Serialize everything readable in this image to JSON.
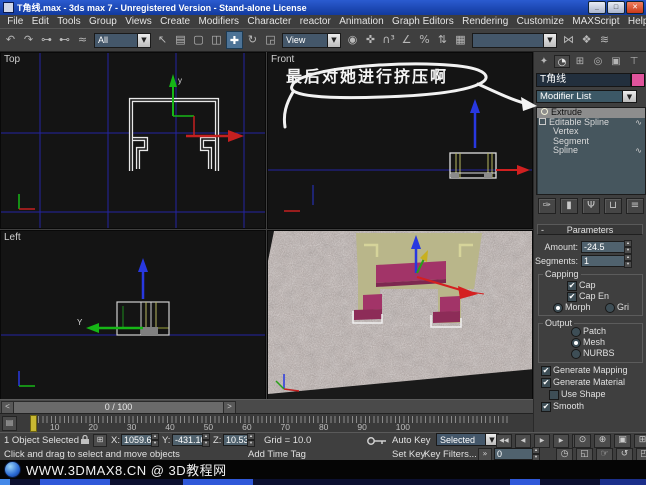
{
  "window": {
    "title": "T角线.max - 3ds max 7 - Unregistered Version - Stand-alone License",
    "minimize": "_",
    "maximize": "□",
    "close": "✕"
  },
  "menu": {
    "items": [
      "File",
      "Edit",
      "Tools",
      "Group",
      "Views",
      "Create",
      "Modifiers",
      "Character",
      "reactor",
      "Animation",
      "Graph Editors",
      "Rendering",
      "Customize",
      "MAXScript",
      "Help"
    ]
  },
  "toolbar": {
    "selection_filter": "All",
    "coord_system": "View",
    "named_selection": "",
    "group_a": [
      {
        "n": "undo-icon",
        "g": "↶"
      },
      {
        "n": "redo-icon",
        "g": "↷"
      },
      {
        "n": "select-and-link-icon",
        "g": "⊶"
      },
      {
        "n": "unlink-selection-icon",
        "g": "⊷"
      },
      {
        "n": "bind-to-spacewarp-icon",
        "g": "≈"
      }
    ],
    "group_b": [
      {
        "n": "select-object-icon",
        "g": "↖"
      },
      {
        "n": "select-by-name-icon",
        "g": "▤"
      },
      {
        "n": "rectangular-selection-icon",
        "g": "▢"
      },
      {
        "n": "window-crossing-icon",
        "g": "◫"
      },
      {
        "n": "select-and-move-icon",
        "g": "✚",
        "cls": "active"
      },
      {
        "n": "select-and-rotate-icon",
        "g": "↻"
      },
      {
        "n": "select-and-scale-icon",
        "g": "◲"
      }
    ],
    "group_c": [
      {
        "n": "use-center-icon",
        "g": "◉"
      },
      {
        "n": "select-and-manipulate-icon",
        "g": "✜"
      },
      {
        "n": "snap-toggle-icon",
        "g": "∩³"
      },
      {
        "n": "angle-snap-icon",
        "g": "∠"
      },
      {
        "n": "percent-snap-icon",
        "g": "%"
      },
      {
        "n": "spinner-snap-icon",
        "g": "⇅"
      },
      {
        "n": "named-selection-sets-icon",
        "g": "▦"
      }
    ],
    "group_d": [
      {
        "n": "mirror-icon",
        "g": "⋈"
      },
      {
        "n": "align-icon",
        "g": "❖"
      },
      {
        "n": "curve-editor-icon",
        "g": "≋"
      }
    ]
  },
  "viewports": {
    "top": {
      "label": "Top",
      "gizmo_axis": "y"
    },
    "front": {
      "label": "Front",
      "annotation": "最后对她进行挤压啊"
    },
    "left": {
      "label": "Left",
      "gizmo_axis": "Y"
    },
    "perspective": {}
  },
  "command_panel": {
    "tabs": [
      {
        "n": "tab-create",
        "g": "✦"
      },
      {
        "n": "tab-modify",
        "g": "◔",
        "cls": "pressed"
      },
      {
        "n": "tab-hierarchy",
        "g": "⊞"
      },
      {
        "n": "tab-motion",
        "g": "◎"
      },
      {
        "n": "tab-display",
        "g": "▣"
      },
      {
        "n": "tab-utilities",
        "g": "⊤"
      }
    ],
    "object_name": "T角线",
    "object_color": "#e0549c",
    "modifier_list_label": "Modifier List",
    "stack": {
      "extrude": "Extrude",
      "editable_spline": "Editable Spline",
      "vertex": "Vertex",
      "segment": "Segment",
      "spline": "Spline"
    },
    "stack_tools": [
      {
        "n": "pin-stack-icon",
        "g": "✑"
      },
      {
        "n": "show-end-result-icon",
        "g": "▮"
      },
      {
        "n": "make-unique-icon",
        "g": "Ψ"
      },
      {
        "n": "remove-modifier-icon",
        "g": "⊔"
      },
      {
        "n": "configure-modifier-sets-icon",
        "g": "≡"
      }
    ],
    "parameters": {
      "collapse": "-",
      "title": "Parameters",
      "amount_label": "Amount:",
      "amount": "-24.5",
      "segments_label": "Segments:",
      "segments": "1",
      "capping_title": "Capping",
      "cap_start": "Cap",
      "cap_end": "Cap En",
      "morph": "Morph",
      "grid": "Gri",
      "output_title": "Output",
      "patch": "Patch",
      "mesh": "Mesh",
      "nurbs": "NURBS",
      "gen_mapping": "Generate Mapping",
      "gen_material": "Generate Material",
      "use_shape": "Use Shape",
      "smooth": "Smooth"
    }
  },
  "timeline": {
    "slider_label": "0 / 100",
    "prev": "<",
    "next": ">",
    "mini_curve_icon": "▤",
    "ticks": [
      "10",
      "20",
      "30",
      "40",
      "50",
      "60",
      "70",
      "80",
      "90",
      "100"
    ]
  },
  "status": {
    "selection": "1 Object Selected",
    "x_label": "X:",
    "x": "1059.64",
    "y_label": "Y:",
    "y": "-431.10",
    "z_label": "Z:",
    "z": "10.53",
    "grid": "Grid = 10.0",
    "auto_key": "Auto Key",
    "set_key": "Set Key",
    "selected_filter": "Selected",
    "key_filters": "Key Filters...",
    "frame": "0",
    "key_step_icon": "»",
    "prompt": "Click and drag to select and move objects",
    "add_time_tag": "Add Time Tag",
    "playback": [
      {
        "n": "go-to-start-icon",
        "g": "◀◀"
      },
      {
        "n": "previous-frame-icon",
        "g": "◀"
      },
      {
        "n": "play-icon",
        "g": "▶"
      },
      {
        "n": "next-frame-icon",
        "g": "▶"
      },
      {
        "n": "go-to-end-icon",
        "g": "▶▶"
      }
    ],
    "nav_row1": [
      {
        "n": "zoom-icon",
        "g": "⊙"
      },
      {
        "n": "zoom-all-icon",
        "g": "⊕"
      },
      {
        "n": "zoom-extents-icon",
        "g": "▣"
      },
      {
        "n": "zoom-extents-all-icon",
        "g": "⊞"
      }
    ],
    "nav_row2": [
      {
        "n": "time-configuration-icon",
        "g": "◷"
      },
      {
        "n": "region-zoom-icon",
        "g": "◱"
      },
      {
        "n": "pan-icon",
        "g": "☞"
      },
      {
        "n": "arc-rotate-icon",
        "g": "↺"
      },
      {
        "n": "min-max-toggle-icon",
        "g": "◰"
      }
    ]
  },
  "watermark": {
    "text": "WWW.3DMAX8.CN @ 3D教程网"
  },
  "icons": {
    "spinner_up": "▴",
    "spinner_down": "▾",
    "dropdown": "▼",
    "check": "✔",
    "wave": "∿"
  },
  "colors": {
    "titlebar": "#1c49b4",
    "active_tool": "#4d7396",
    "object_color": "#e0549c",
    "selected_faces": "#a23468",
    "surface_olive": "#b9b68a",
    "grid_blue": "#2525a8",
    "timeline_marker": "#c8b832",
    "field_blue": "#50626e",
    "watermark_logo": "#2a6ad4"
  }
}
